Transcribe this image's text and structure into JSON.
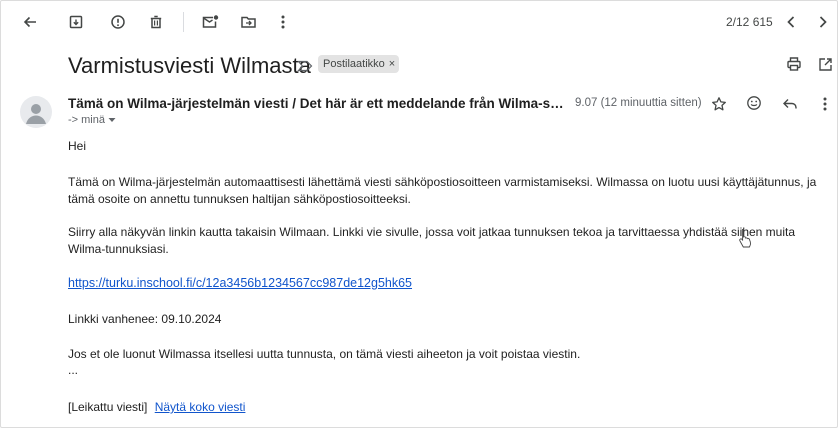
{
  "toolbar": {
    "back_icon": "arrow-left-icon",
    "archive_icon": "archive-icon",
    "spam_icon": "report-spam-icon",
    "delete_icon": "trash-icon",
    "unread_icon": "mark-unread-icon",
    "move_icon": "move-to-icon",
    "more_icon": "more-vert-icon",
    "counter": "2/12 615",
    "prev_icon": "chevron-left-icon",
    "next_icon": "chevron-right-icon"
  },
  "subject": {
    "title": "Varmistusviesti Wilmasta",
    "label": "Postilaatikko",
    "label_remove": "×",
    "print_icon": "print-icon",
    "open_new_window_icon": "open-in-new-icon"
  },
  "message": {
    "sender": "Tämä on Wilma-järjestelmän viesti / Det här är ett meddelande från Wilma-syste...",
    "time": "9.07 (12 minuuttia sitten)",
    "to": "-> minä",
    "star_icon": "star-icon",
    "emoji_icon": "emoji-icon",
    "reply_icon": "reply-icon",
    "more_icon": "more-vert-icon",
    "greeting": "Hei",
    "para1": "Tämä on Wilma-järjestelmän automaattisesti lähettämä viesti sähköpostiosoitteen varmistamiseksi. Wilmassa on luotu uusi käyttäjätunnus, ja tämä osoite on annettu tunnuksen haltijan sähköpostiosoitteeksi.",
    "para2": "Siirry alla näkyvän linkin kautta takaisin Wilmaan. Linkki vie sivulle, jossa voit jatkaa tunnuksen tekoa ja tarvittaessa yhdistää siihen muita Wilma-tunnuksiasi.",
    "link": "https://turku.inschool.fi/c/12a3456b1234567cc987de12g5hk65",
    "expiry": "Linkki vanhenee: 09.10.2024",
    "para3": "Jos et ole luonut Wilmassa itsellesi uutta tunnusta, on tämä viesti aiheeton ja voit poistaa viestin.",
    "ellipsis": "...",
    "clipped": "[Leikattu viesti]",
    "show_full": "Näytä koko viesti"
  }
}
